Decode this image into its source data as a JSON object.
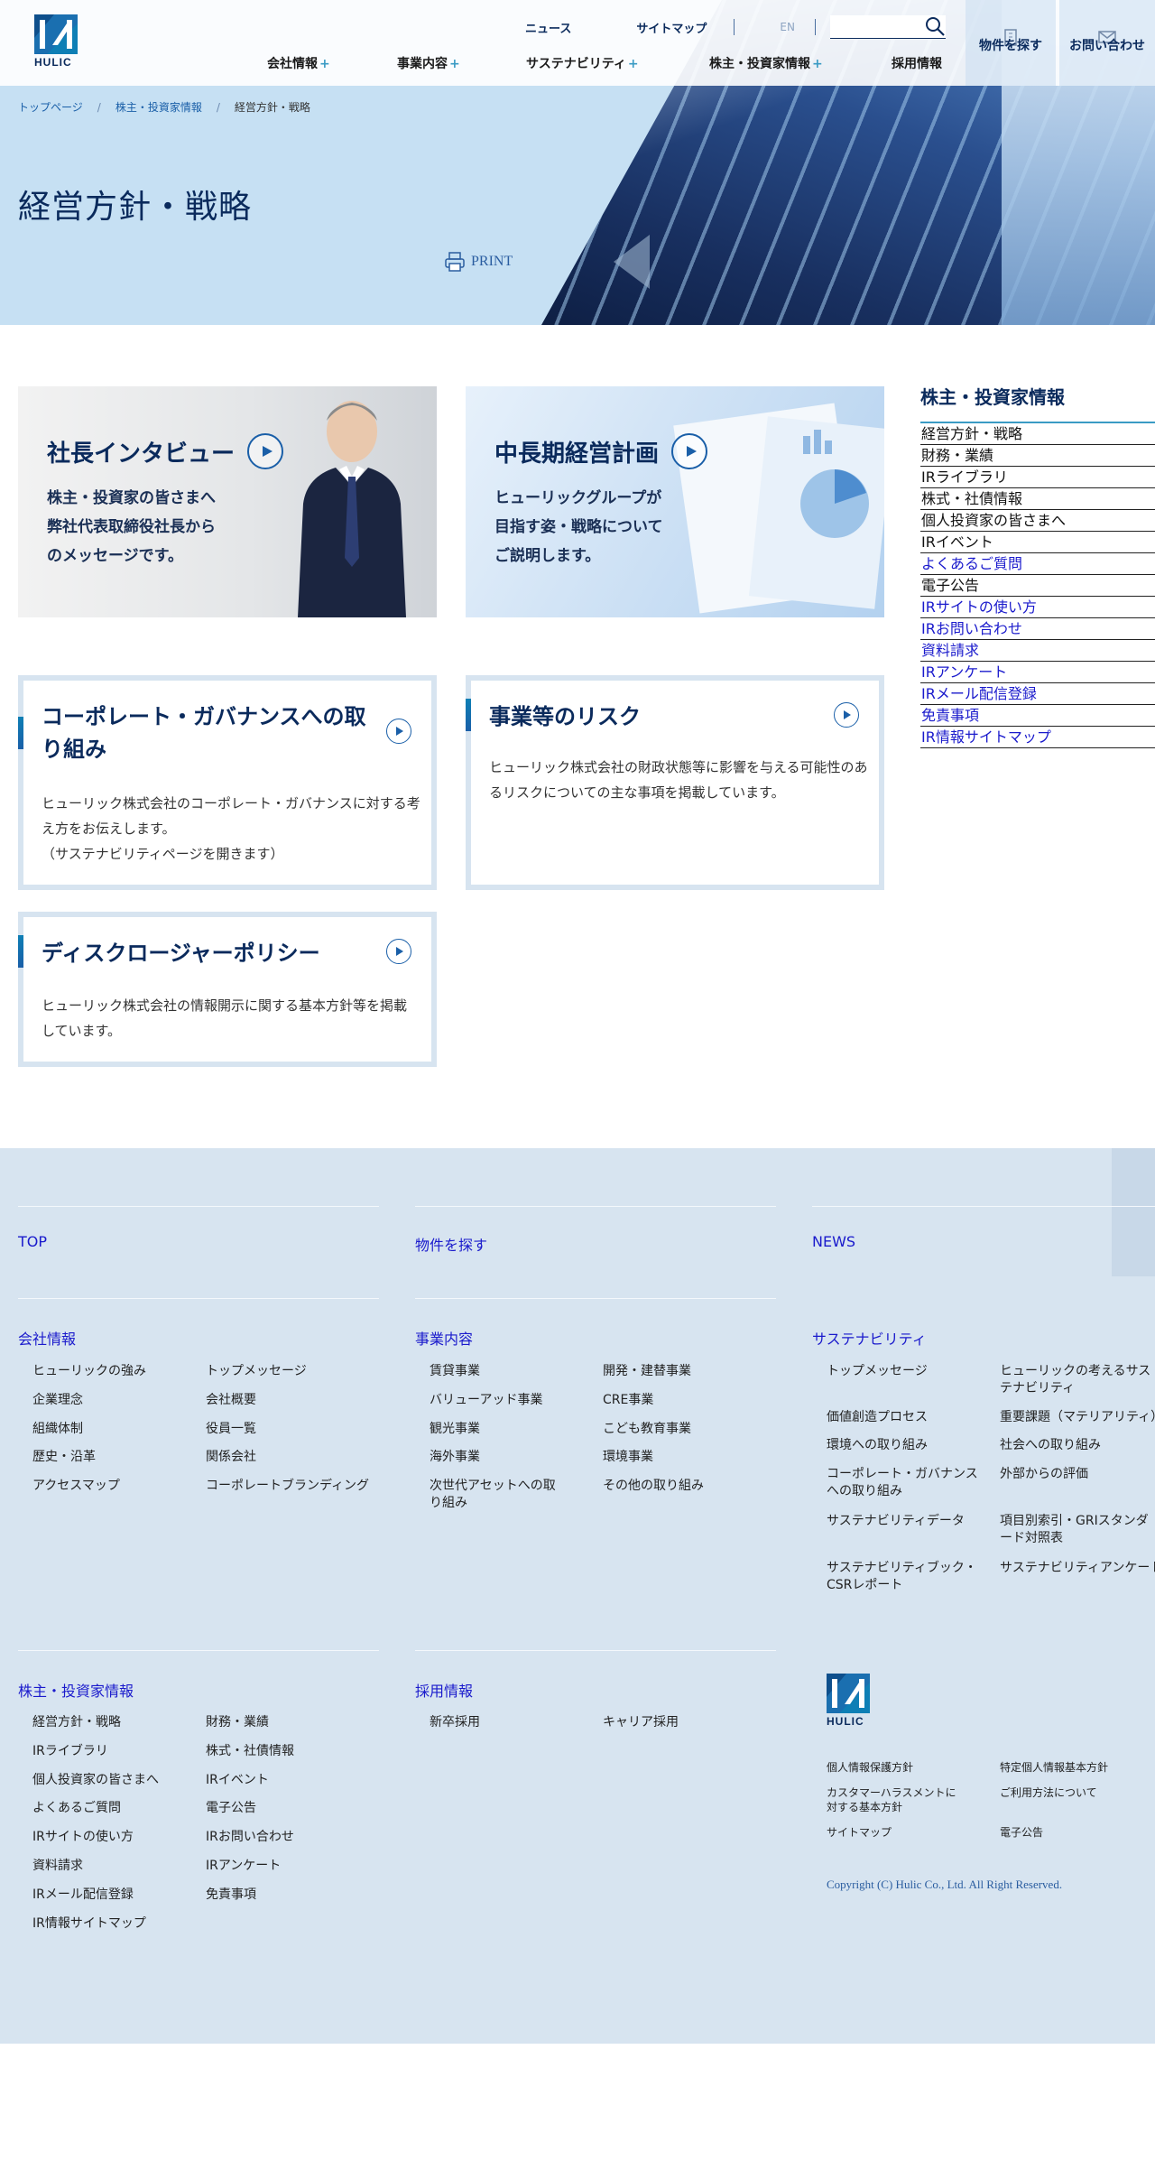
{
  "header": {
    "logo_text": "HULIC",
    "util_links": [
      "ニュース",
      "サイトマップ"
    ],
    "lang": "EN",
    "search_placeholder": "",
    "nav": [
      {
        "label": "会社情報",
        "plus": "+"
      },
      {
        "label": "事業内容",
        "plus": "+"
      },
      {
        "label": "サステナビリティ",
        "plus": "+"
      },
      {
        "label": "株主・投資家情報",
        "plus": "+"
      },
      {
        "label": "採用情報",
        "plus": ""
      }
    ],
    "find_property": "物件を探す",
    "contact": "お問い合わせ"
  },
  "breadcrumb": {
    "items": [
      "トップページ",
      "株主・投資家情報"
    ],
    "separator": "/",
    "current": "経営方針・戦略"
  },
  "page": {
    "title": "経営方針・戦略",
    "print_label": "PRINT"
  },
  "banners": [
    {
      "title": "社長インタビュー",
      "lines": [
        "株主・投資家の皆さまへ",
        "弊社代表取締役社長から",
        "のメッセージです。"
      ]
    },
    {
      "title": "中長期経営計画",
      "lines": [
        "ヒューリックグループが",
        "目指す姿・戦略について",
        "ご説明します。"
      ]
    }
  ],
  "cards": [
    {
      "title": "コーポレート・ガバナンスへの取り組み",
      "lines": [
        "ヒューリック株式会社のコーポレート・ガバナンスに対する考え方をお伝えします。",
        "（サステナビリティページを開きます）"
      ]
    },
    {
      "title": "事業等のリスク",
      "lines": [
        "ヒューリック株式会社の財政状態等に影響を与える可能性のあるリスクについての主な事項を掲載しています。"
      ]
    },
    {
      "title": "ディスクロージャーポリシー",
      "lines": [
        "ヒューリック株式会社の情報開示に関する基本方針等を掲載しています。"
      ]
    }
  ],
  "sidebar": {
    "title": "株主・投資家情報",
    "items": [
      {
        "label": "経営方針・戦略",
        "link": false
      },
      {
        "label": "財務・業績",
        "link": false
      },
      {
        "label": "IRライブラリ",
        "link": false
      },
      {
        "label": "株式・社債情報",
        "link": false
      },
      {
        "label": "個人投資家の皆さまへ",
        "link": false
      },
      {
        "label": "IRイベント",
        "link": false
      },
      {
        "label": "よくあるご質問",
        "link": true
      },
      {
        "label": "電子公告",
        "link": false
      },
      {
        "label": "IRサイトの使い方",
        "link": true
      },
      {
        "label": "IRお問い合わせ",
        "link": true
      },
      {
        "label": "資料請求",
        "link": true
      },
      {
        "label": "IRアンケート",
        "link": true
      },
      {
        "label": "IRメール配信登録",
        "link": true
      },
      {
        "label": "免責事項",
        "link": true
      },
      {
        "label": "IR情報サイトマップ",
        "link": true
      }
    ]
  },
  "footer": {
    "top_links": [
      "TOP",
      "物件を探す",
      "NEWS"
    ],
    "company": {
      "title": "会社情報",
      "links": [
        "ヒューリックの強み",
        "トップメッセージ",
        "企業理念",
        "会社概要",
        "組織体制",
        "役員一覧",
        "歴史・沿革",
        "関係会社",
        "アクセスマップ",
        "コーポレートブランディング"
      ]
    },
    "business": {
      "title": "事業内容",
      "links": [
        "賃貸事業",
        "開発・建替事業",
        "バリューアッド事業",
        "CRE事業",
        "観光事業",
        "こども教育事業",
        "海外事業",
        "環境事業",
        "次世代アセットへの取り組み",
        "その他の取り組み"
      ]
    },
    "sustainability": {
      "title": "サステナビリティ",
      "links": [
        "トップメッセージ",
        "ヒューリックの考えるサステナビリティ",
        "価値創造プロセス",
        "重要課題（マテリアリティ）",
        "環境への取り組み",
        "社会への取り組み",
        "コーポレート・ガバナンスへの取り組み",
        "外部からの評価",
        "サステナビリティデータ",
        "項目別索引・GRIスタンダード対照表",
        "サステナビリティブック・CSRレポート",
        "サステナビリティアンケート"
      ]
    },
    "ir": {
      "title": "株主・投資家情報",
      "links": [
        "経営方針・戦略",
        "財務・業績",
        "IRライブラリ",
        "株式・社債情報",
        "個人投資家の皆さまへ",
        "IRイベント",
        "よくあるご質問",
        "電子公告",
        "IRサイトの使い方",
        "IRお問い合わせ",
        "資料請求",
        "IRアンケート",
        "IRメール配信登録",
        "免責事項",
        "IR情報サイトマップ"
      ]
    },
    "recruit": {
      "title": "採用情報",
      "links": [
        "新卒採用",
        "キャリア採用"
      ]
    },
    "legal": [
      "個人情報保護方針",
      "特定個人情報基本方針",
      "カスタマーハラスメントに対する基本方針",
      "ご利用方法について",
      "サイトマップ",
      "電子公告"
    ],
    "logo_text": "HULIC",
    "copyright": "Copyright (C) Hulic Co., Ltd. All Right Reserved."
  },
  "colors": {
    "brand_navy": "#0a2a5c",
    "accent_blue": "#1a5fa8",
    "accent_teal": "#3a9bc4",
    "link_blue": "#1a1acc",
    "footer_bg": "#d7e4f0"
  }
}
